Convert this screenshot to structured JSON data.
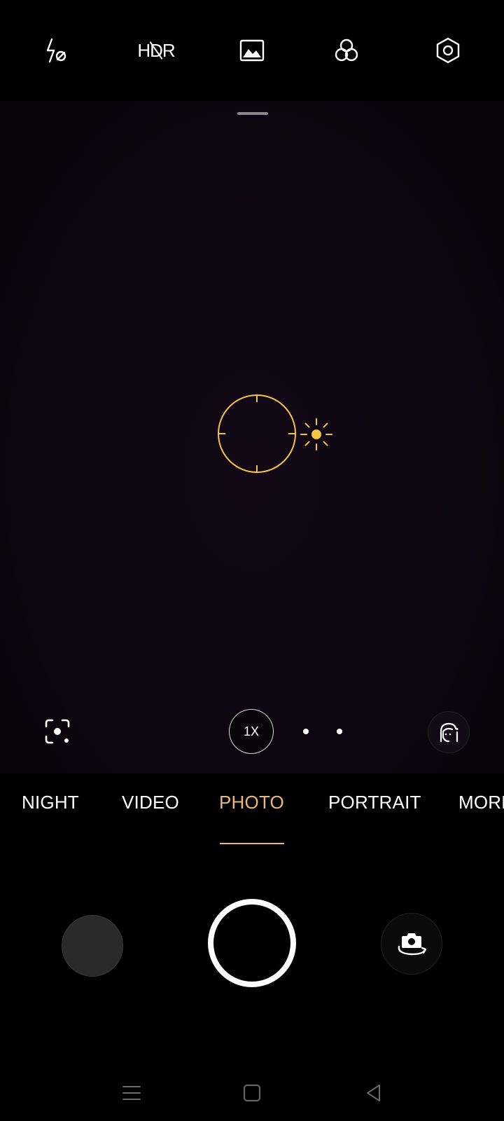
{
  "top_bar": {
    "icons": [
      "flash-off-icon",
      "hdr-off-icon",
      "scene-icon",
      "filter-icon",
      "settings-icon"
    ],
    "hdr_label": "HDR"
  },
  "viewfinder": {
    "zoom_label": "1X",
    "accent_color": "#f5c542"
  },
  "modes": [
    {
      "label": "NIGHT",
      "active": false
    },
    {
      "label": "VIDEO",
      "active": false
    },
    {
      "label": "PHOTO",
      "active": true
    },
    {
      "label": "PORTRAIT",
      "active": false
    },
    {
      "label": "MORE",
      "active": false
    }
  ],
  "active_mode_color": "#e9b97c",
  "capture": {
    "left": "gallery-thumbnail",
    "center": "shutter-button",
    "right": "switch-camera-icon"
  },
  "nav": {
    "icons": [
      "menu-icon",
      "home-icon",
      "back-icon"
    ]
  }
}
